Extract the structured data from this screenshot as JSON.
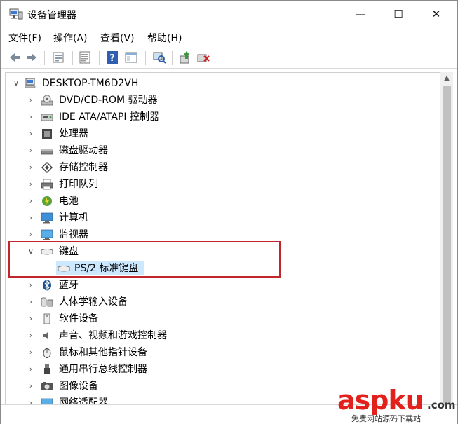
{
  "window": {
    "title": "设备管理器",
    "controls": {
      "minimize": "—",
      "maximize": "☐",
      "close": "✕"
    }
  },
  "menu": {
    "items": [
      "文件(F)",
      "操作(A)",
      "查看(V)",
      "帮助(H)"
    ]
  },
  "toolbar": {
    "icons": [
      "back-arrow-icon",
      "forward-arrow-icon",
      "properties-icon",
      "show-hidden-icon",
      "help-icon",
      "view-icon",
      "scan-icon",
      "update-driver-icon",
      "uninstall-icon"
    ]
  },
  "tree": {
    "root": "DESKTOP-TM6D2VH",
    "categories": [
      {
        "label": "DVD/CD-ROM 驱动器",
        "icon": "dvd-drive-icon",
        "expanded": false
      },
      {
        "label": "IDE ATA/ATAPI 控制器",
        "icon": "ide-controller-icon",
        "expanded": false
      },
      {
        "label": "处理器",
        "icon": "processor-icon",
        "expanded": false
      },
      {
        "label": "磁盘驱动器",
        "icon": "disk-drive-icon",
        "expanded": false
      },
      {
        "label": "存储控制器",
        "icon": "storage-controller-icon",
        "expanded": false
      },
      {
        "label": "打印队列",
        "icon": "printer-icon",
        "expanded": false
      },
      {
        "label": "电池",
        "icon": "battery-icon",
        "expanded": false
      },
      {
        "label": "计算机",
        "icon": "computer-icon",
        "expanded": false
      },
      {
        "label": "监视器",
        "icon": "monitor-icon",
        "expanded": false
      },
      {
        "label": "键盘",
        "icon": "keyboard-icon",
        "expanded": true,
        "children": [
          "PS/2 标准键盘"
        ]
      },
      {
        "label": "蓝牙",
        "icon": "bluetooth-icon",
        "expanded": false
      },
      {
        "label": "人体学输入设备",
        "icon": "hid-icon",
        "expanded": false
      },
      {
        "label": "软件设备",
        "icon": "software-device-icon",
        "expanded": false
      },
      {
        "label": "声音、视频和游戏控制器",
        "icon": "audio-icon",
        "expanded": false
      },
      {
        "label": "鼠标和其他指针设备",
        "icon": "mouse-icon",
        "expanded": false
      },
      {
        "label": "通用串行总线控制器",
        "icon": "usb-icon",
        "expanded": false
      },
      {
        "label": "图像设备",
        "icon": "camera-icon",
        "expanded": false
      },
      {
        "label": "网络适配器",
        "icon": "network-adapter-icon",
        "expanded": false
      }
    ]
  },
  "watermark": {
    "main": "asp",
    "ku": "ku",
    "dotcom": ".com",
    "sub": "免费网站源码下载站"
  },
  "colors": {
    "highlight_border": "#c0272d",
    "selection": "#cce8ff",
    "watermark": "#e2211c"
  }
}
